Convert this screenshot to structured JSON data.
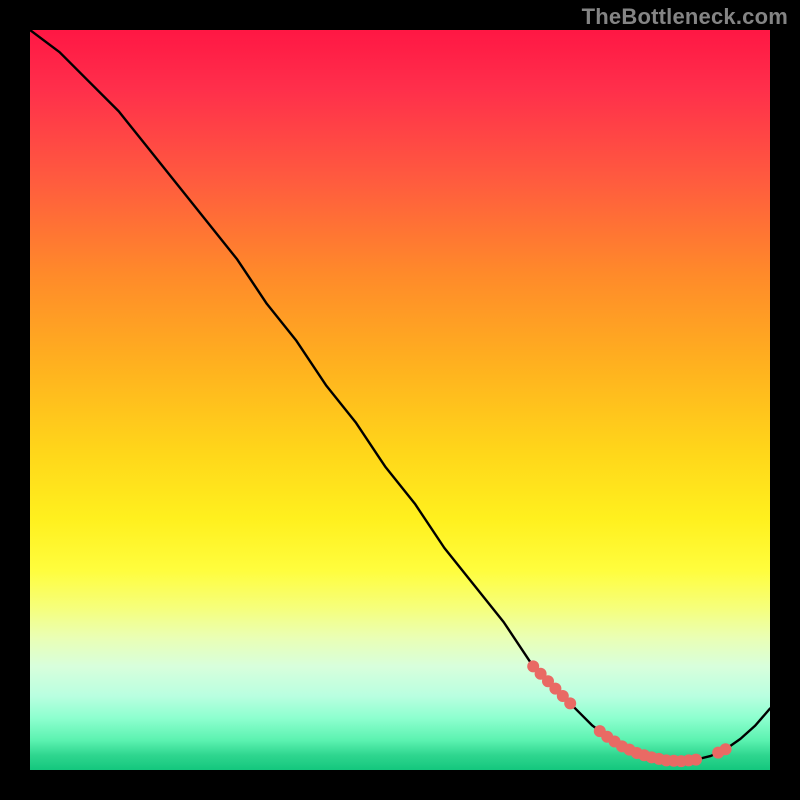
{
  "watermark": "TheBottleneck.com",
  "colors": {
    "dot": "#e96a64",
    "curve": "#000000"
  },
  "chart_data": {
    "type": "line",
    "title": "",
    "xlabel": "",
    "ylabel": "",
    "xlim": [
      0,
      100
    ],
    "ylim": [
      0,
      100
    ],
    "series": [
      {
        "name": "curve",
        "x": [
          0,
          4,
          8,
          12,
          16,
          20,
          24,
          28,
          32,
          36,
          40,
          44,
          48,
          52,
          56,
          60,
          64,
          68,
          70,
          72,
          74,
          76,
          78,
          80,
          82,
          84,
          86,
          88,
          90,
          92,
          94,
          96,
          98,
          100
        ],
        "y": [
          100,
          97,
          93,
          89,
          84,
          79,
          74,
          69,
          63,
          58,
          52,
          47,
          41,
          36,
          30,
          25,
          20,
          14,
          12,
          10,
          8,
          6,
          4.5,
          3.2,
          2.3,
          1.7,
          1.3,
          1.2,
          1.4,
          1.9,
          2.8,
          4.2,
          6.0,
          8.3
        ]
      }
    ],
    "annotations": {
      "highlight_dots_x": [
        68,
        69,
        70,
        71,
        72,
        73,
        77,
        78,
        79,
        80,
        81,
        82,
        83,
        84,
        85,
        86,
        87,
        88,
        89,
        90,
        93,
        94
      ]
    }
  }
}
